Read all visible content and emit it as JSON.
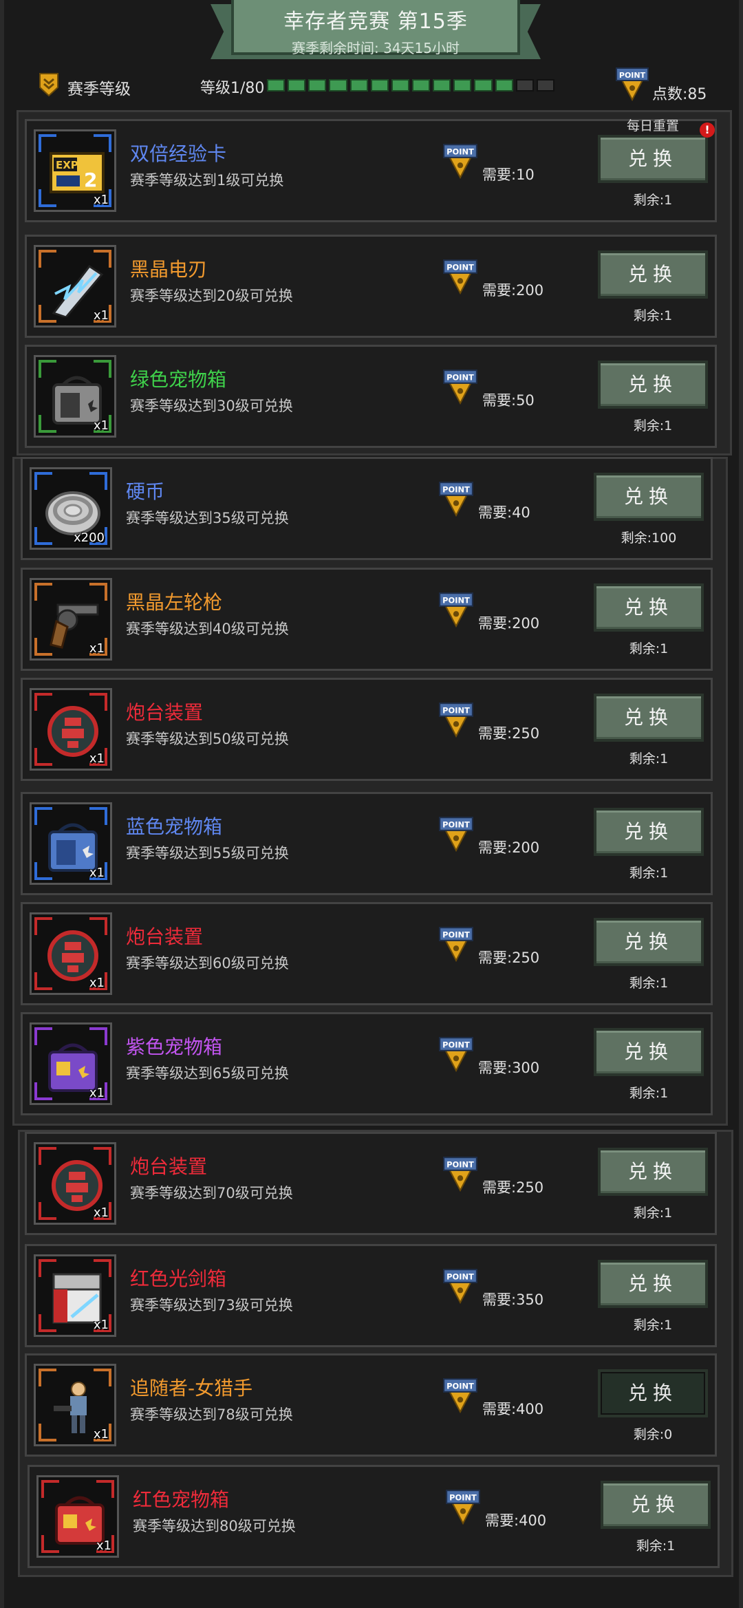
{
  "title": "幸存者竞赛 第15季",
  "subtitle": "赛季剩余时间: 34天15小时",
  "header": {
    "season_label": "赛季等级",
    "level_text": "等级1/80",
    "level_progress_fraction": 0.85,
    "points_text": "点数:85",
    "point_badge_text": "POINT"
  },
  "button_label": "兑换",
  "daily_reset_label": "每日重置",
  "alert_mark": "!",
  "items": [
    {
      "name": "双倍经验卡",
      "color": "#5f87f0",
      "req": "赛季等级达到1级可兑换",
      "cost": "需要:10",
      "remain": "剩余:1",
      "qty": "x1",
      "icon": "exp-card-icon",
      "frame": "#2f6cd8"
    },
    {
      "name": "黑晶电刃",
      "color": "#f29a2e",
      "req": "赛季等级达到20级可兑换",
      "cost": "需要:200",
      "remain": "剩余:1",
      "qty": "x1",
      "icon": "lightning-blade-icon",
      "frame": "#c8702a"
    },
    {
      "name": "绿色宠物箱",
      "color": "#3fd24b",
      "req": "赛季等级达到30级可兑换",
      "cost": "需要:50",
      "remain": "剩余:1",
      "qty": "x1",
      "icon": "green-pet-crate-icon",
      "frame": "#3a9a3a"
    },
    {
      "name": "硬币",
      "color": "#5f87f0",
      "req": "赛季等级达到35级可兑换",
      "cost": "需要:40",
      "remain": "剩余:100",
      "qty": "x200",
      "icon": "coin-icon",
      "frame": "#2f6cd8"
    },
    {
      "name": "黑晶左轮枪",
      "color": "#f29a2e",
      "req": "赛季等级达到40级可兑换",
      "cost": "需要:200",
      "remain": "剩余:1",
      "qty": "x1",
      "icon": "revolver-icon",
      "frame": "#c8702a"
    },
    {
      "name": "炮台装置",
      "color": "#ef2b3a",
      "req": "赛季等级达到50级可兑换",
      "cost": "需要:250",
      "remain": "剩余:1",
      "qty": "x1",
      "icon": "turret-device-icon",
      "frame": "#c42a2a"
    },
    {
      "name": "蓝色宠物箱",
      "color": "#5f87f0",
      "req": "赛季等级达到55级可兑换",
      "cost": "需要:200",
      "remain": "剩余:1",
      "qty": "x1",
      "icon": "blue-pet-crate-icon",
      "frame": "#2f6cd8"
    },
    {
      "name": "炮台装置",
      "color": "#ef2b3a",
      "req": "赛季等级达到60级可兑换",
      "cost": "需要:250",
      "remain": "剩余:1",
      "qty": "x1",
      "icon": "turret-device-icon",
      "frame": "#c42a2a"
    },
    {
      "name": "紫色宠物箱",
      "color": "#c255f0",
      "req": "赛季等级达到65级可兑换",
      "cost": "需要:300",
      "remain": "剩余:1",
      "qty": "x1",
      "icon": "purple-pet-crate-icon",
      "frame": "#8a3ad0"
    },
    {
      "name": "炮台装置",
      "color": "#ef2b3a",
      "req": "赛季等级达到70级可兑换",
      "cost": "需要:250",
      "remain": "剩余:1",
      "qty": "x1",
      "icon": "turret-device-icon",
      "frame": "#c42a2a"
    },
    {
      "name": "红色光剑箱",
      "color": "#ef2b3a",
      "req": "赛季等级达到73级可兑换",
      "cost": "需要:350",
      "remain": "剩余:1",
      "qty": "x1",
      "icon": "red-saber-crate-icon",
      "frame": "#c42a2a"
    },
    {
      "name": "追随者-女猎手",
      "color": "#f29a2e",
      "req": "赛季等级达到78级可兑换",
      "cost": "需要:400",
      "remain": "剩余:0",
      "qty": "x1",
      "icon": "huntress-follower-icon",
      "frame": "#c8702a",
      "disabled": true
    },
    {
      "name": "红色宠物箱",
      "color": "#ef2b3a",
      "req": "赛季等级达到80级可兑换",
      "cost": "需要:400",
      "remain": "剩余:1",
      "qty": "x1",
      "icon": "red-pet-crate-icon",
      "frame": "#c42a2a"
    }
  ]
}
